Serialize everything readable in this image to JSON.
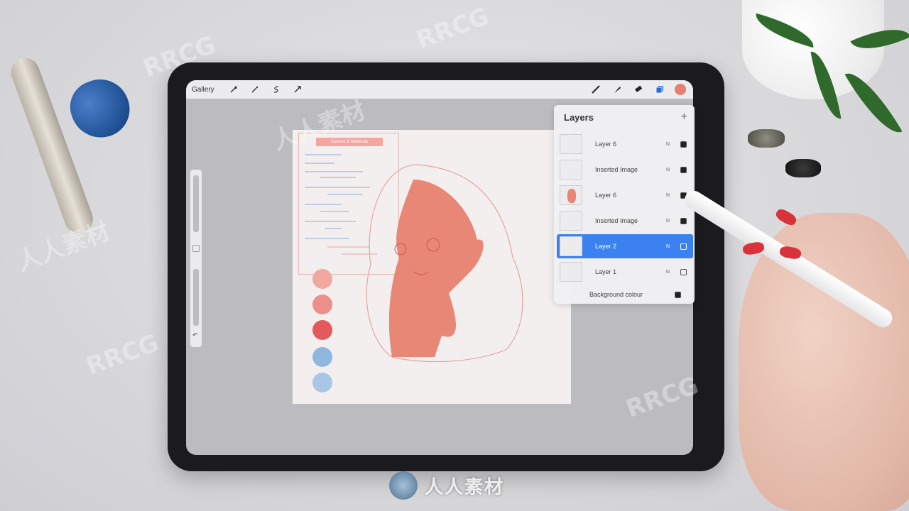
{
  "toolbar": {
    "gallery_label": "Gallery",
    "left_icons": [
      "wrench-icon",
      "magic-wand-icon",
      "selection-icon",
      "move-arrow-icon"
    ],
    "right_icons": [
      "brush-icon",
      "smudge-icon",
      "eraser-icon",
      "layers-icon"
    ],
    "current_color": "#e87d74"
  },
  "canvas": {
    "notes_title": "Colours & Materials",
    "swatches": [
      "#f0a89f",
      "#ec8f8c",
      "#e45a5b",
      "#8fb8e0",
      "#a9c6e6"
    ]
  },
  "layers_panel": {
    "title": "Layers",
    "add_symbol": "+",
    "layers": [
      {
        "name": "Layer 6",
        "blend": "N",
        "visible": true,
        "active": false
      },
      {
        "name": "Inserted Image",
        "blend": "N",
        "visible": true,
        "active": false
      },
      {
        "name": "Layer 6",
        "blend": "N",
        "visible": true,
        "active": false
      },
      {
        "name": "Inserted Image",
        "blend": "N",
        "visible": true,
        "active": false
      },
      {
        "name": "Layer 2",
        "blend": "N",
        "visible": false,
        "active": true
      },
      {
        "name": "Layer 1",
        "blend": "N",
        "visible": false,
        "active": false
      }
    ],
    "background": {
      "name": "Background colour",
      "visible": true
    }
  },
  "watermark": {
    "brand": "RRCG",
    "cn": "人人素材",
    "logo_text": "人人素材"
  }
}
